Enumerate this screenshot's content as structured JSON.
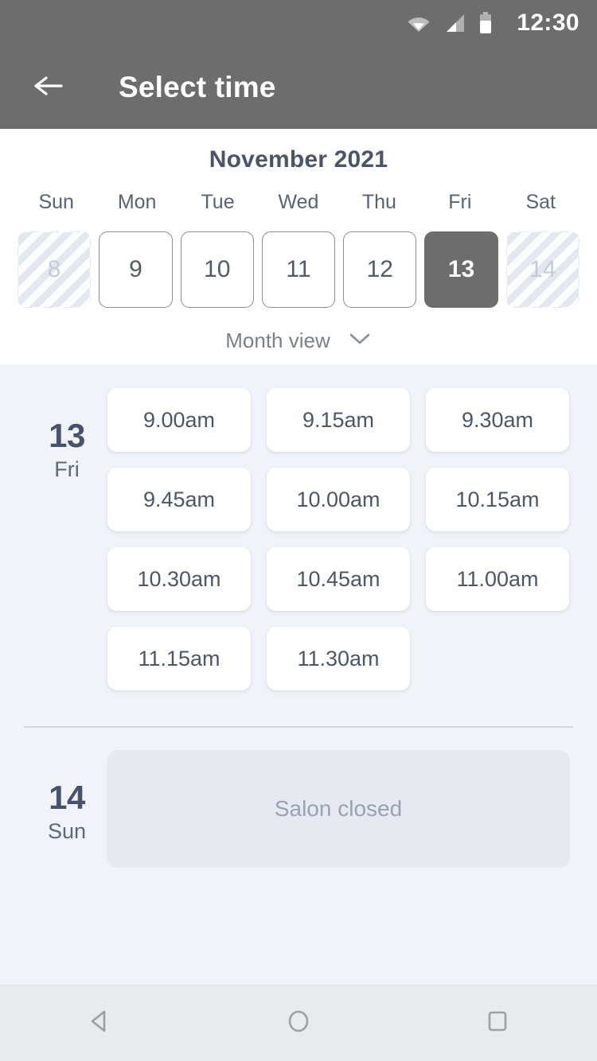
{
  "status_bar": {
    "time": "12:30",
    "icons": [
      "wifi-icon",
      "signal-icon",
      "battery-icon"
    ]
  },
  "app_bar": {
    "back_icon": "arrow-left-icon",
    "title": "Select time"
  },
  "calendar": {
    "month_title": "November 2021",
    "weekdays": [
      "Sun",
      "Mon",
      "Tue",
      "Wed",
      "Thu",
      "Fri",
      "Sat"
    ],
    "dates": [
      {
        "day": "8",
        "state": "disabled"
      },
      {
        "day": "9",
        "state": "available"
      },
      {
        "day": "10",
        "state": "available"
      },
      {
        "day": "11",
        "state": "available"
      },
      {
        "day": "12",
        "state": "available"
      },
      {
        "day": "13",
        "state": "selected"
      },
      {
        "day": "14",
        "state": "disabled"
      }
    ],
    "month_view_label": "Month view",
    "month_view_icon": "chevron-down-icon"
  },
  "schedule": {
    "days": [
      {
        "day_number": "13",
        "weekday": "Fri",
        "slots": [
          "9.00am",
          "9.15am",
          "9.30am",
          "9.45am",
          "10.00am",
          "10.15am",
          "10.30am",
          "10.45am",
          "11.00am",
          "11.15am",
          "11.30am"
        ]
      },
      {
        "day_number": "14",
        "weekday": "Sun",
        "closed_message": "Salon closed"
      }
    ]
  },
  "nav_bar": {
    "back_icon": "nav-back-triangle-icon",
    "home_icon": "nav-home-circle-icon",
    "recents_icon": "nav-recents-square-icon"
  },
  "colors": {
    "app_bar": "#6d6d6d",
    "page_background": "#f0f3f8",
    "calendar_background": "#ffffff",
    "selected_date": "#6d6d6d",
    "text_primary": "#46536b",
    "text_muted": "#98a2b3",
    "nav_bar": "#e8eaed"
  }
}
